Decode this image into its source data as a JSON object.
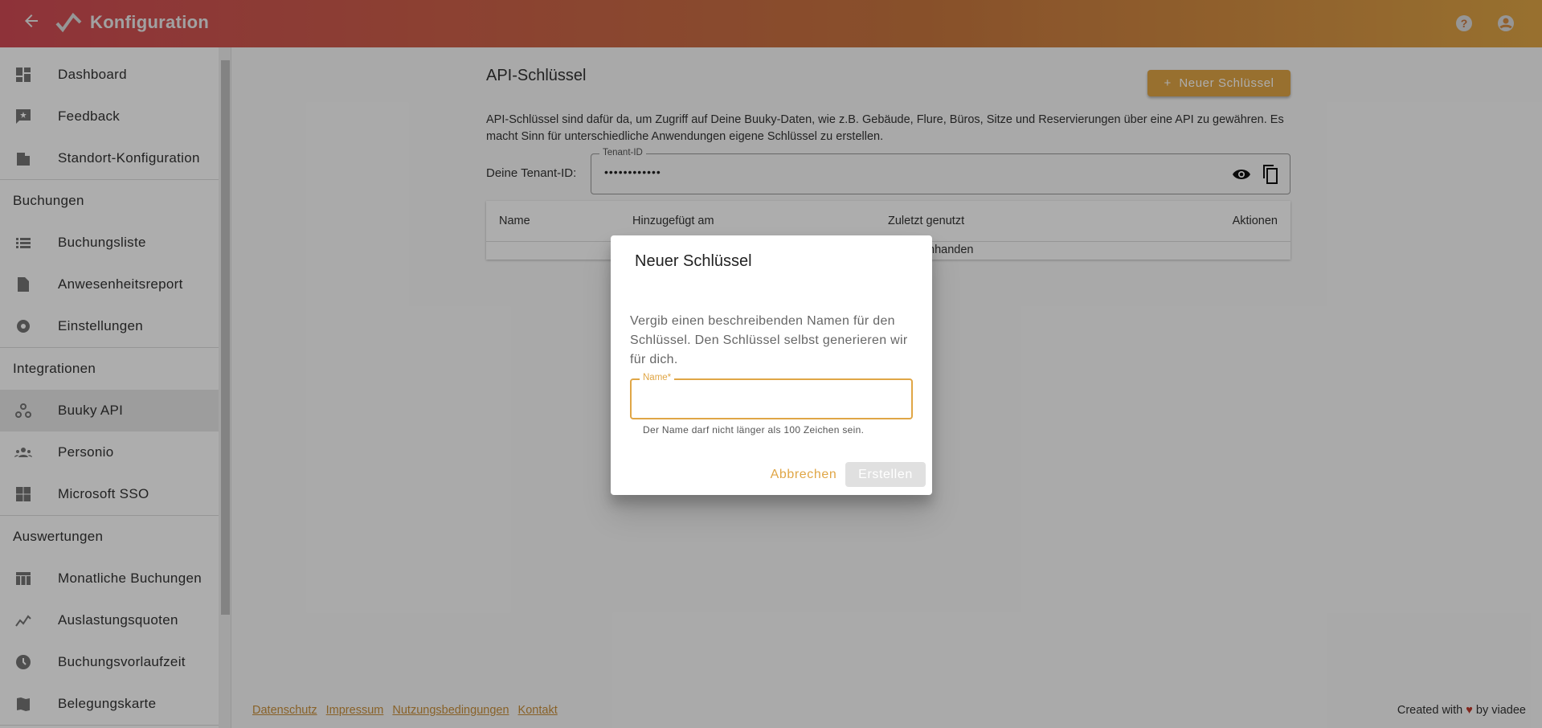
{
  "header": {
    "title": "Konfiguration",
    "back_icon": "arrow-left-icon",
    "logo_icon": "buuky-logo-icon",
    "help_icon": "help-circle-icon",
    "account_icon": "account-circle-icon",
    "gradient": [
      "#d24b55",
      "#e0a646"
    ]
  },
  "sidebar": {
    "items": [
      {
        "label": "Dashboard",
        "icon": "dashboard-icon"
      },
      {
        "label": "Feedback",
        "icon": "feedback-icon"
      },
      {
        "label": "Standort-Konfiguration",
        "icon": "building-icon"
      },
      {
        "label": "Buchungsliste",
        "icon": "list-icon"
      },
      {
        "label": "Anwesenheitsreport",
        "icon": "report-icon"
      },
      {
        "label": "Einstellungen",
        "icon": "gear-icon"
      },
      {
        "label": "Buuky API",
        "icon": "webhook-icon",
        "selected": true
      },
      {
        "label": "Personio",
        "icon": "people-icon"
      },
      {
        "label": "Microsoft SSO",
        "icon": "windows-icon"
      },
      {
        "label": "Monatliche Buchungen",
        "icon": "table-icon"
      },
      {
        "label": "Auslastungsquoten",
        "icon": "chart-line-icon"
      },
      {
        "label": "Buchungsvorlaufzeit",
        "icon": "clock-icon"
      },
      {
        "label": "Belegungskarte",
        "icon": "map-icon"
      }
    ],
    "sections": [
      "Buchungen",
      "Integrationen",
      "Auswertungen"
    ]
  },
  "main": {
    "title": "API-Schlüssel",
    "new_button": "Neuer Schlüssel",
    "description": "API-Schlüssel sind dafür da, um Zugriff auf Deine Buuky-Daten, wie z.B. Gebäude, Flure, Büros, Sitze und Reservierungen über eine API zu gewähren. Es macht Sinn für unterschiedliche Anwendungen eigene Schlüssel zu erstellen.",
    "tenant_label": "Deine Tenant-ID:",
    "tenant_field_label": "Tenant-ID",
    "tenant_value": "••••••••••••",
    "table": {
      "columns": [
        "Name",
        "Hinzugefügt am",
        "Zuletzt genutzt",
        "Aktionen"
      ],
      "empty_text_visible": "nhanden"
    }
  },
  "footer": {
    "links": [
      "Datenschutz",
      "Impressum",
      "Nutzungsbedingungen",
      "Kontakt"
    ],
    "credit_prefix": "Created with",
    "credit_suffix": "by viadee"
  },
  "modal": {
    "title": "Neuer Schlüssel",
    "text": "Vergib einen beschreibenden Namen für den Schlüssel. Den Schlüssel selbst generieren wir für dich.",
    "field_label": "Name*",
    "field_value": "",
    "hint": "Der Name darf nicht länger als 100 Zeichen sein.",
    "cancel": "Abbrechen",
    "create": "Erstellen"
  },
  "colors": {
    "accent": "#e0a646",
    "selected_bg": "#e8e8e8"
  }
}
